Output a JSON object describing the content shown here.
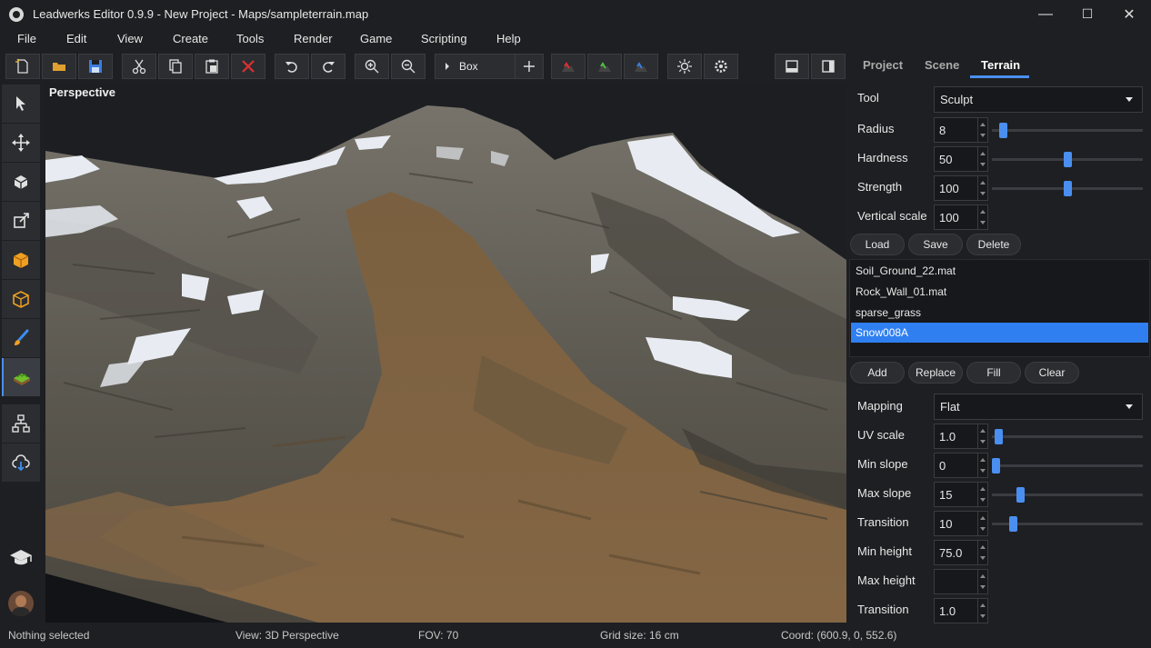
{
  "window": {
    "title": "Leadwerks Editor 0.9.9 - New Project - Maps/sampleterrain.map",
    "minimize": "—",
    "maximize": "☐",
    "close": "✕"
  },
  "menu": [
    "File",
    "Edit",
    "View",
    "Create",
    "Tools",
    "Render",
    "Game",
    "Scripting",
    "Help"
  ],
  "toolbar": {
    "object_type": "Box",
    "icons": [
      "new-file-icon",
      "open-folder-icon",
      "save-icon",
      "cut-icon",
      "copy-icon",
      "paste-icon",
      "delete-icon",
      "undo-icon",
      "redo-icon",
      "zoom-in-icon",
      "zoom-out-icon",
      "play-icon",
      "plus-icon",
      "terrain-red-icon",
      "terrain-green-icon",
      "terrain-blue-icon",
      "sun-icon",
      "gear-icon",
      "single-view-icon",
      "panel-view-icon"
    ]
  },
  "lefttools": [
    "select-arrow-icon",
    "move-icon",
    "rotate-cube-icon",
    "scale-icon",
    "solid-cube-icon",
    "vertex-icon",
    "paint-brush-icon",
    "terrain-icon",
    "hierarchy-icon",
    "cloud-download-icon",
    "graduation-cap-icon",
    "user-avatar"
  ],
  "viewport": {
    "label": "Perspective"
  },
  "panel": {
    "tabs": [
      "Project",
      "Scene",
      "Terrain"
    ],
    "active_tab": "Terrain",
    "tool_label": "Tool",
    "tool_value": "Sculpt",
    "radius_label": "Radius",
    "radius_value": "8",
    "radius_level": 0.05,
    "hardness_label": "Hardness",
    "hardness_value": "50",
    "hardness_level": 0.5,
    "strength_label": "Strength",
    "strength_value": "100",
    "strength_level": 0.5,
    "vscale_label": "Vertical scale",
    "vscale_value": "100",
    "load_label": "Load",
    "save_label": "Save",
    "delete_label": "Delete",
    "materials": [
      "Soil_Ground_22.mat",
      "Rock_Wall_01.mat",
      "sparse_grass",
      "Snow008A"
    ],
    "selected_material": "Snow008A",
    "add_label": "Add",
    "replace_label": "Replace",
    "fill_label": "Fill",
    "clear_label": "Clear",
    "mapping_label": "Mapping",
    "mapping_value": "Flat",
    "uvscale_label": "UV scale",
    "uvscale_value": "1.0",
    "uvscale_level": 0.02,
    "minslope_label": "Min slope",
    "minslope_value": "0",
    "minslope_level": 0.0,
    "maxslope_label": "Max slope",
    "maxslope_value": "15",
    "maxslope_level": 0.17,
    "transition1_label": "Transition",
    "transition1_value": "10",
    "transition1_level": 0.12,
    "minheight_label": "Min height",
    "minheight_value": "75.0",
    "maxheight_label": "Max height",
    "maxheight_value": "",
    "transition2_label": "Transition",
    "transition2_value": "1.0"
  },
  "status": {
    "selection": "Nothing selected",
    "view": "View: 3D Perspective",
    "fov": "FOV: 70",
    "grid": "Grid size: 16 cm",
    "coord": "Coord: (600.9, 0, 552.6)"
  },
  "colors": {
    "accent": "#4a8ff0",
    "background": "#1e1f22",
    "selection": "#2f7ff0"
  }
}
